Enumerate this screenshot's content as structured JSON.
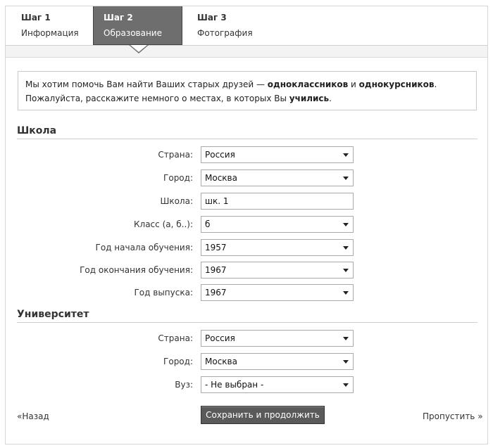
{
  "steps": [
    {
      "title": "Шаг 1",
      "subtitle": "Информация"
    },
    {
      "title": "Шаг 2",
      "subtitle": "Образование"
    },
    {
      "title": "Шаг 3",
      "subtitle": "Фотография"
    }
  ],
  "active_step": 2,
  "message": {
    "line1_a": "Мы хотим помочь Вам найти Ваших старых друзей — ",
    "line1_b": "одноклассников",
    "line1_c": " и ",
    "line1_d": "однокурсников",
    "line1_e": ".",
    "line2_a": "Пожалуйста, расскажите немного о местах, в которых Вы ",
    "line2_b": "учились",
    "line2_c": "."
  },
  "school": {
    "title": "Школа",
    "fields": [
      {
        "label": "Страна:",
        "value": "Россия",
        "type": "select"
      },
      {
        "label": "Город:",
        "value": "Москва",
        "type": "select"
      },
      {
        "label": "Школа:",
        "value": "шк. 1",
        "type": "text"
      },
      {
        "label": "Класс (а, б..):",
        "value": "б",
        "type": "select"
      },
      {
        "label": "Год начала обучения:",
        "value": "1957",
        "type": "select"
      },
      {
        "label": "Год окончания обучения:",
        "value": "1967",
        "type": "select"
      },
      {
        "label": "Год выпуска:",
        "value": "1967",
        "type": "select"
      }
    ]
  },
  "university": {
    "title": "Университет",
    "fields": [
      {
        "label": "Страна:",
        "value": "Россия",
        "type": "select"
      },
      {
        "label": "Город:",
        "value": "Москва",
        "type": "select"
      },
      {
        "label": "Вуз:",
        "value": "- Не выбран -",
        "type": "select"
      }
    ]
  },
  "actions": {
    "back": "«Назад",
    "save": "Сохранить и продолжить",
    "skip": "Пропустить »"
  },
  "icons": {
    "dropdown": "chevron-down-icon"
  }
}
